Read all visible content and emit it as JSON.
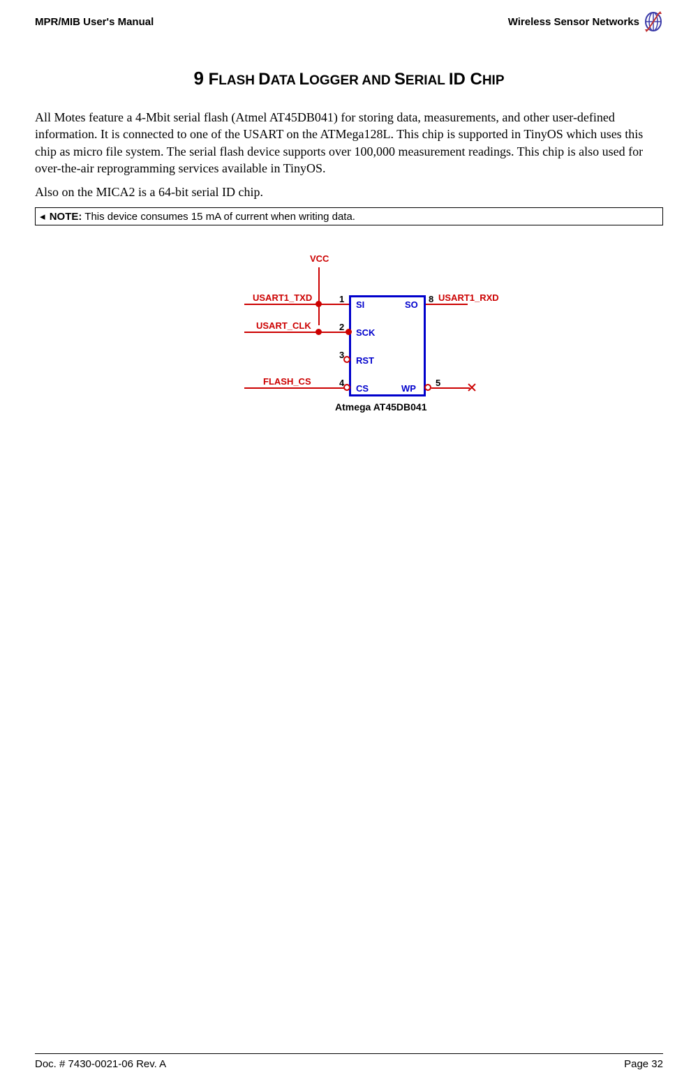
{
  "header": {
    "left": "MPR/MIB User's Manual",
    "right": "Wireless Sensor Networks"
  },
  "chapter": {
    "number": "9",
    "title_part1": "F",
    "title_rest1": "LASH ",
    "title_part2": "D",
    "title_rest2": "ATA ",
    "title_part3": "L",
    "title_rest3": "OGGER AND ",
    "title_part4": "S",
    "title_rest4": "ERIAL ",
    "title_part5": "ID C",
    "title_rest5": "HIP"
  },
  "paragraphs": {
    "p1": "All Motes feature a 4-Mbit serial flash (Atmel AT45DB041) for storing data, measurements, and other user-defined information. It is connected to one of the USART on the ATMega128L. This chip is supported in TinyOS which uses this chip as micro file system. The serial flash device supports over 100,000 measurement readings. This chip is also used for over-the-air reprogramming services available in TinyOS.",
    "p2": "Also on the MICA2 is a 64-bit serial ID chip."
  },
  "note": {
    "label": "NOTE:",
    "text": "This device consumes 15 mA of current when writing data."
  },
  "diagram": {
    "signals": {
      "vcc": "VCC",
      "usart1_txd": "USART1_TXD",
      "usart_clk": "USART_CLK",
      "flash_cs": "FLASH_CS",
      "usart1_rxd": "USART1_RXD"
    },
    "pins": {
      "si": "SI",
      "so": "SO",
      "sck": "SCK",
      "rst": "RST",
      "cs": "CS",
      "wp": "WP"
    },
    "pin_nums": {
      "p1": "1",
      "p2": "2",
      "p3": "3",
      "p4": "4",
      "p5": "5",
      "p8": "8"
    },
    "caption": "Atmega AT45DB041"
  },
  "footer": {
    "left": "Doc. # 7430-0021-06 Rev. A",
    "right": "Page 32"
  }
}
